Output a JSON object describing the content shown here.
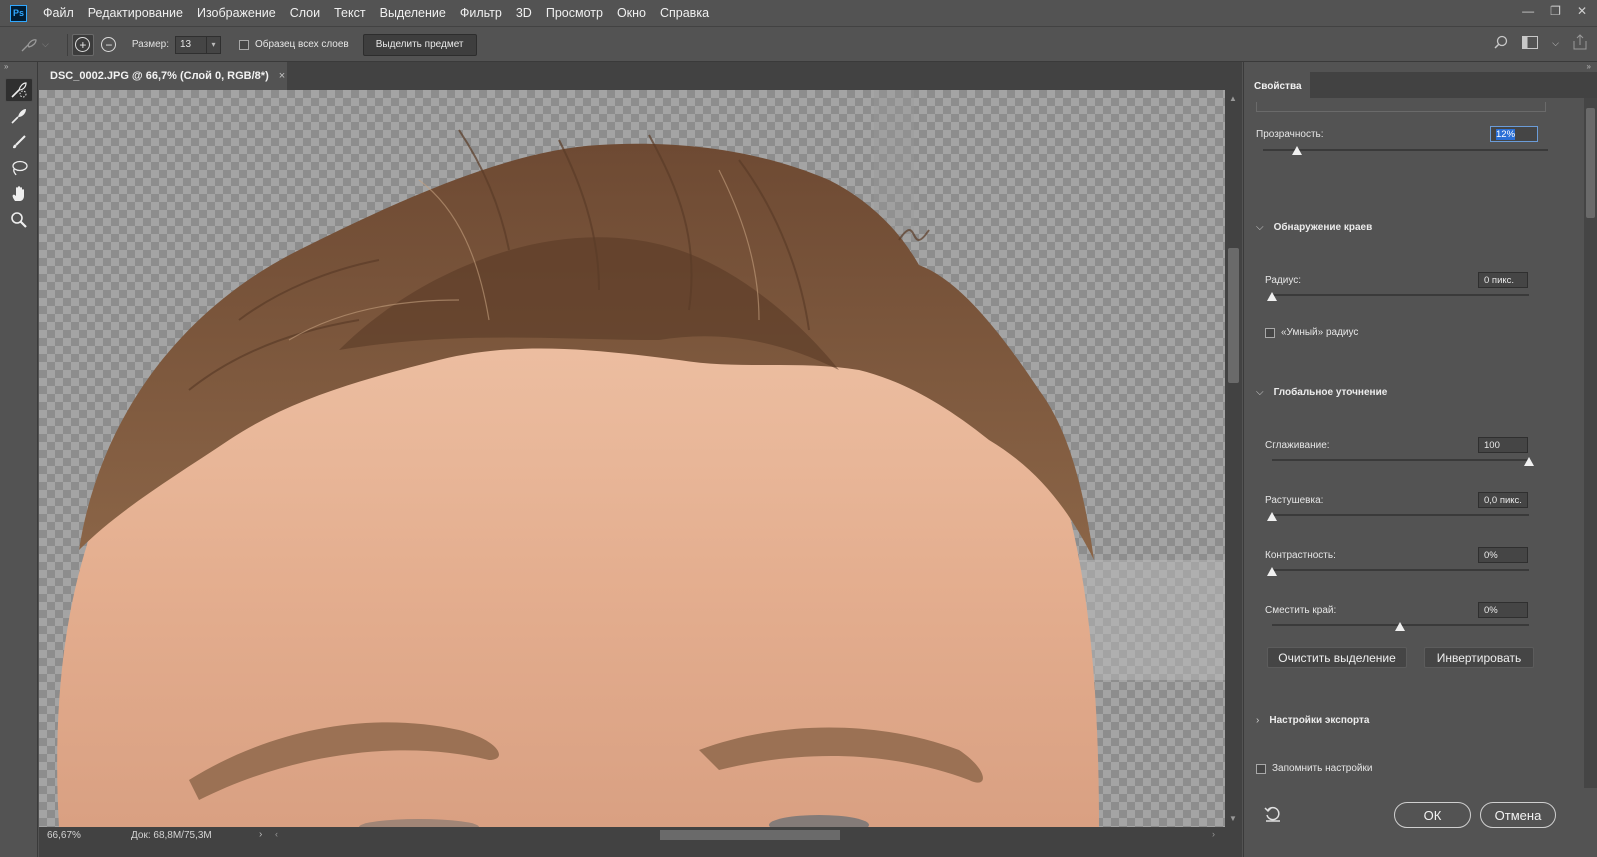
{
  "app": {
    "logo": "Ps"
  },
  "menu": [
    "Файл",
    "Редактирование",
    "Изображение",
    "Слои",
    "Текст",
    "Выделение",
    "Фильтр",
    "3D",
    "Просмотр",
    "Окно",
    "Справка"
  ],
  "window_controls": [
    "—",
    "❐",
    "✕"
  ],
  "options": {
    "size_label": "Размер:",
    "size_value": "13",
    "sample_all_label": "Образец всех слоев",
    "select_subject_label": "Выделить предмет"
  },
  "document": {
    "tab_title": "DSC_0002.JPG @ 66,7% (Слой 0, RGB/8*)",
    "close": "×",
    "zoom": "66,67%",
    "doc_size": "Док: 68,8M/75,3M"
  },
  "tools": [
    "quick-selection-icon",
    "refine-edge-brush-icon",
    "brush-icon",
    "lasso-icon",
    "hand-icon",
    "zoom-icon"
  ],
  "properties": {
    "tab": "Свойства",
    "opacity_label": "Прозрачность:",
    "opacity_value": "12%",
    "opacity_level": 0.12,
    "edge_detection": {
      "title": "Обнаружение краев",
      "radius_label": "Радиус:",
      "radius_value": "0 пикс.",
      "smart_radius_label": "«Умный» радиус"
    },
    "global_refinements": {
      "title": "Глобальное уточнение",
      "smooth_label": "Сглаживание:",
      "smooth_value": "100",
      "feather_label": "Растушевка:",
      "feather_value": "0,0 пикс.",
      "contrast_label": "Контрастность:",
      "contrast_value": "0%",
      "shift_edge_label": "Сместить край:",
      "shift_edge_value": "0%",
      "clear_selection": "Очистить выделение",
      "invert": "Инвертировать"
    },
    "export": {
      "title": "Настройки экспорта"
    },
    "remember_label": "Запомнить настройки",
    "ok": "ОК",
    "cancel": "Отмена"
  }
}
